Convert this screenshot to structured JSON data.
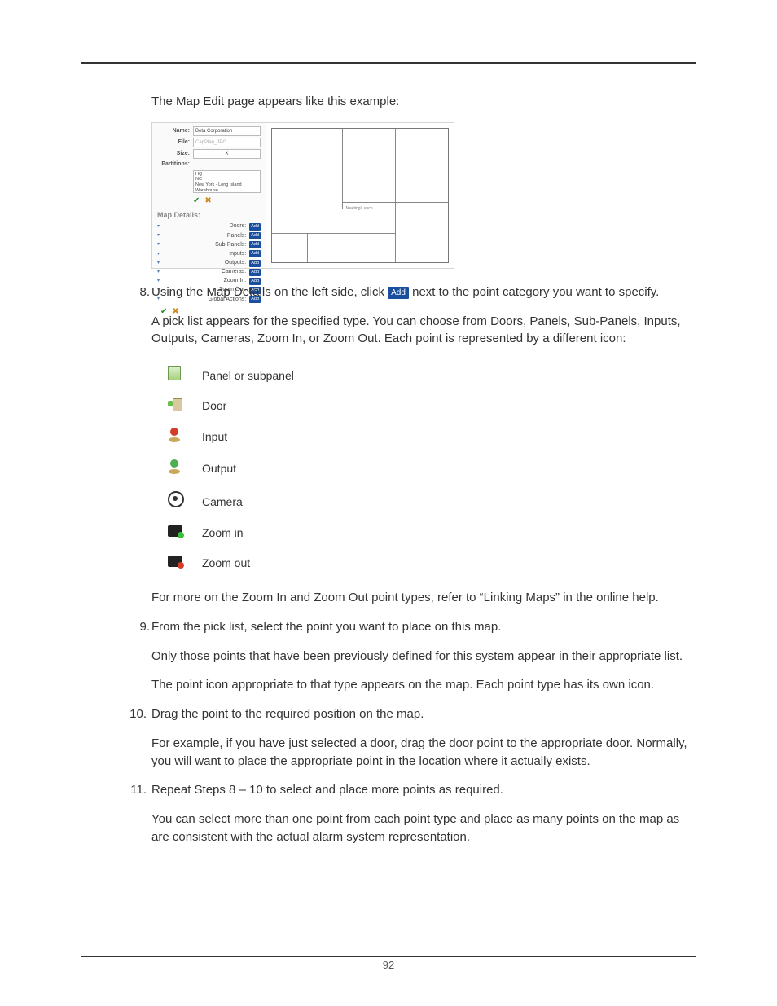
{
  "page_number": "92",
  "intro": "The Map Edit page appears like this example:",
  "screenshot": {
    "fields": {
      "name_label": "Name:",
      "name_value": "Beta Corporation",
      "file_label": "File:",
      "file_value": "CapPlan_JPG",
      "size_label": "Size:",
      "size_x": "X",
      "partitions_label": "Partitions:",
      "partitions": [
        "HQ",
        "NC",
        "New York - Long Island Warehouse"
      ]
    },
    "map_details_label": "Map Details:",
    "details": [
      {
        "name": "Doors:"
      },
      {
        "name": "Panels:"
      },
      {
        "name": "Sub-Panels:"
      },
      {
        "name": "Inputs:"
      },
      {
        "name": "Outputs:"
      },
      {
        "name": "Cameras:"
      },
      {
        "name": "Zoom In:"
      },
      {
        "name": "Zoom Out:"
      },
      {
        "name": "Global Actions:"
      }
    ],
    "add_label": "Add",
    "floor_label": "Meeting/Lunch"
  },
  "step8": {
    "num": "8.",
    "p1a": "Using the Map Details on the left side, click ",
    "add_label": "Add",
    "p1b": " next to the point category you want to specify.",
    "p2": "A pick list appears for the specified type. You can choose from Doors, Panels, Sub-Panels, Inputs, Outputs, Cameras, Zoom In, or Zoom Out. Each point is represented by a different icon:",
    "icons": [
      {
        "key": "panel",
        "label": "Panel or subpanel"
      },
      {
        "key": "door",
        "label": "Door"
      },
      {
        "key": "input",
        "label": "Input"
      },
      {
        "key": "output",
        "label": "Output"
      },
      {
        "key": "camera",
        "label": "Camera"
      },
      {
        "key": "zoomin",
        "label": "Zoom in"
      },
      {
        "key": "zoomout",
        "label": "Zoom out"
      }
    ],
    "p3": "For more on the Zoom In and Zoom Out point types, refer to “Linking Maps” in the online help."
  },
  "step9": {
    "num": "9.",
    "p1": "From the pick list, select the point you want to place on this map.",
    "p2": "Only those points that have been previously defined for this system appear in their appropriate list.",
    "p3": "The point icon appropriate to that type appears on the map. Each point type has its own icon."
  },
  "step10": {
    "num": "10.",
    "p1": "Drag the point to the required position on the map.",
    "p2": "For example, if you have just selected a door, drag the door point to the appropriate door. Normally, you will want to place the appropriate point in the location where it actually exists."
  },
  "step11": {
    "num": "11.",
    "p1": "Repeat Steps 8 – 10 to select and place more points as required.",
    "p2": "You can select more than one point from each point type and place as many points on the map as are consistent with the actual alarm system representation."
  }
}
